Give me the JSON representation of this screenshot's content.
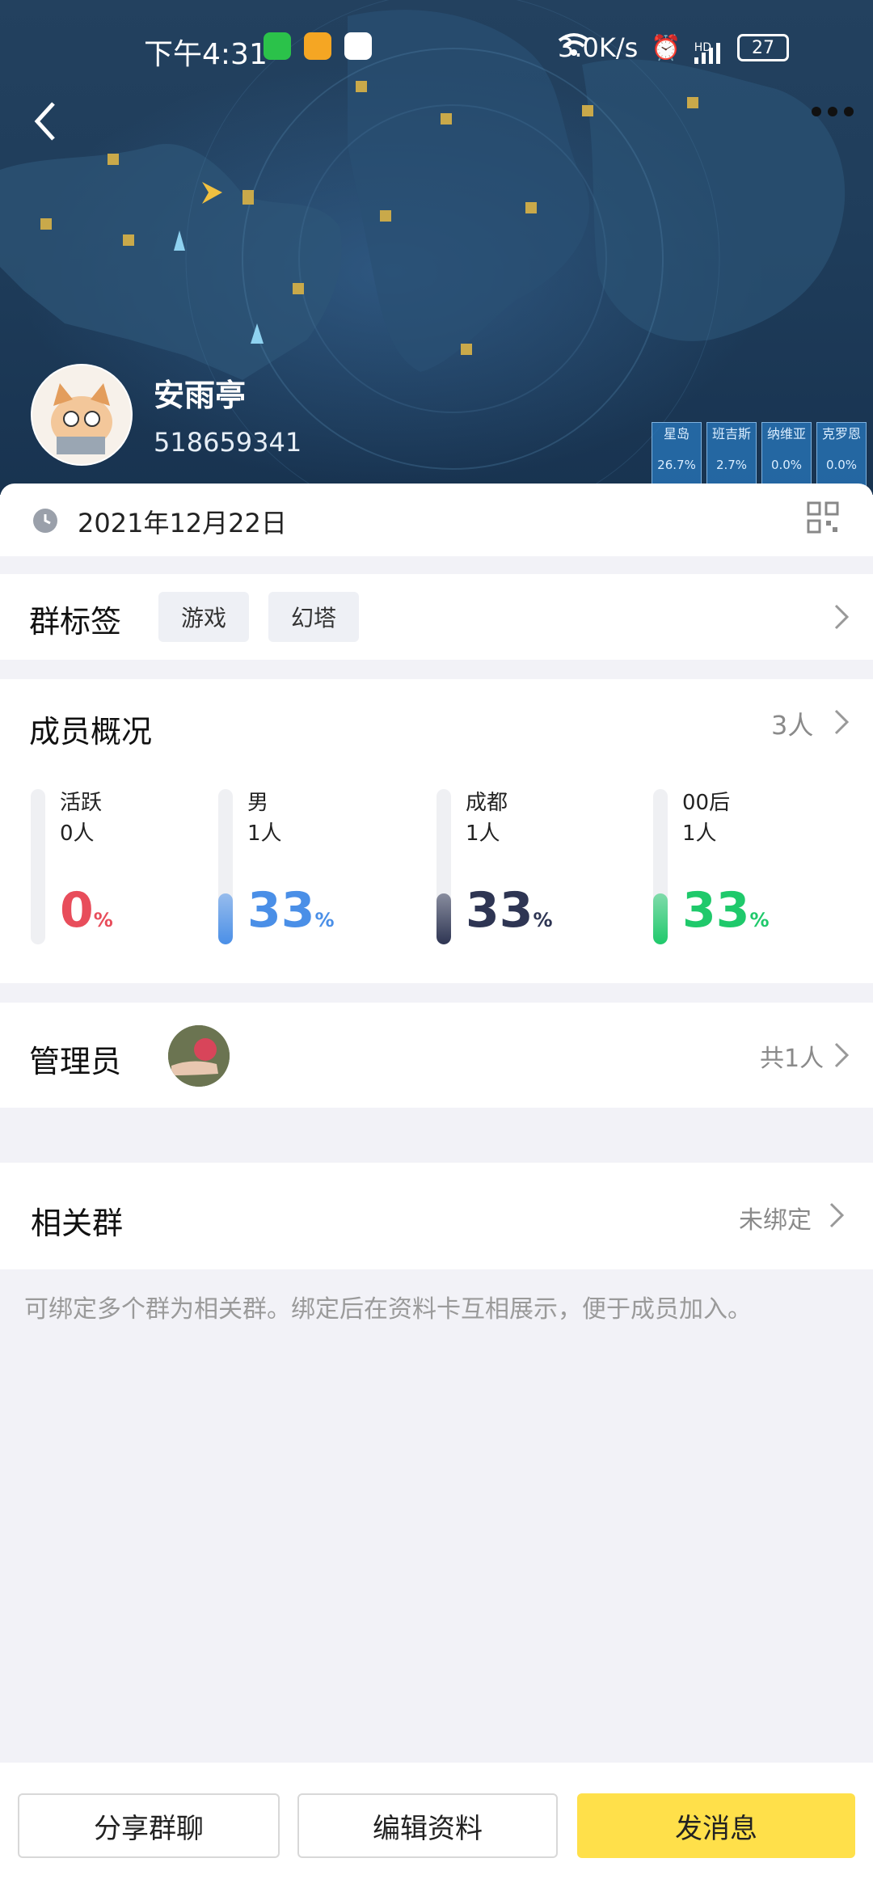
{
  "status_bar": {
    "time": "下午4:31",
    "network_speed": "3.0K/s",
    "hd": "HD",
    "battery": "27"
  },
  "header": {
    "group_name": "安雨亭",
    "group_id": "518659341",
    "back_icon": "chevron-left-icon",
    "more_icon": "more-dots-icon",
    "regions": [
      {
        "name": "星岛",
        "percent": "26.7%"
      },
      {
        "name": "班吉斯",
        "percent": "2.7%"
      },
      {
        "name": "纳维亚",
        "percent": "0.0%"
      },
      {
        "name": "克罗恩",
        "percent": "0.0%"
      }
    ]
  },
  "date_row": {
    "date": "2021年12月22日",
    "icon": "clock-icon",
    "qr_icon": "qr-code-icon"
  },
  "tags": {
    "title": "群标签",
    "items": [
      "游戏",
      "幻塔"
    ]
  },
  "members": {
    "title": "成员概况",
    "total": "3人",
    "stats": [
      {
        "label": "活跃",
        "count": "0人",
        "value": "0",
        "unit": "%",
        "fraction": 0.0,
        "color": "#e84d5b"
      },
      {
        "label": "男",
        "count": "1人",
        "value": "33",
        "unit": "%",
        "fraction": 0.33,
        "color": "#4a8fe7"
      },
      {
        "label": "成都",
        "count": "1人",
        "value": "33",
        "unit": "%",
        "fraction": 0.33,
        "color": "#2e3553"
      },
      {
        "label": "00后",
        "count": "1人",
        "value": "33",
        "unit": "%",
        "fraction": 0.33,
        "color": "#1fc96b"
      }
    ]
  },
  "admin": {
    "title": "管理员",
    "count": "共1人"
  },
  "related": {
    "title": "相关群",
    "status": "未绑定",
    "hint": "可绑定多个群为相关群。绑定后在资料卡互相展示，便于成员加入。"
  },
  "bottom": {
    "share": "分享群聊",
    "edit": "编辑资料",
    "message": "发消息"
  },
  "colors": {
    "primary_button": "#ffe04a"
  }
}
